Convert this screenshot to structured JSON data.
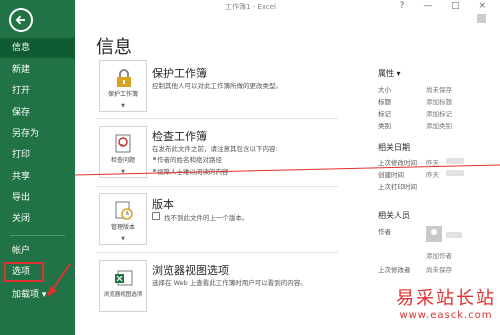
{
  "window": {
    "title": "工作簿1 - Excel",
    "controls": "? — □ ×"
  },
  "nav": {
    "items": [
      {
        "label": "信息",
        "active": true
      },
      {
        "label": "新建"
      },
      {
        "label": "打开"
      },
      {
        "label": "保存"
      },
      {
        "label": "另存为"
      },
      {
        "label": "打印"
      },
      {
        "label": "共享"
      },
      {
        "label": "导出"
      },
      {
        "label": "关闭"
      },
      {
        "label": "帐户"
      },
      {
        "label": "选项",
        "highlighted": true
      },
      {
        "label": "加载项 ▾"
      }
    ]
  },
  "main": {
    "page_title": "信息",
    "sections": [
      {
        "tile_label": "保护工作簿",
        "heading": "保护工作簿",
        "desc": "控制其他人可以对此工作簿所做的更改类型。",
        "icon": "lock-icon"
      },
      {
        "tile_label": "检查问题",
        "heading": "检查工作簿",
        "desc": "在发布此文件之前，请注意其包含以下内容:",
        "bullets": [
          "作者的姓名和绝对路径",
          "视障人士难以阅读的内容"
        ],
        "icon": "inspect-icon"
      },
      {
        "tile_label": "管理版本",
        "heading": "版本",
        "desc": "找不到此文件的上一个版本。",
        "icon": "versions-icon"
      },
      {
        "tile_label": "浏览器视图选项",
        "heading": "浏览器视图选项",
        "desc": "选择在 Web 上查看此工作簿时用户可以看到的内容。",
        "icon": "excel-browser-icon"
      }
    ]
  },
  "properties": {
    "heading": "属性 ▾",
    "rows": [
      {
        "key": "大小",
        "val": "尚未保存"
      },
      {
        "key": "标题",
        "val": "添加标题"
      },
      {
        "key": "标记",
        "val": "添加标记"
      },
      {
        "key": "类别",
        "val": "添加类别"
      }
    ],
    "dates_heading": "相关日期",
    "dates": [
      {
        "key": "上次修改时间",
        "val": "昨天"
      },
      {
        "key": "创建时间",
        "val": "昨天"
      },
      {
        "key": "上次打印时间",
        "val": ""
      }
    ],
    "people_heading": "相关人员",
    "people": [
      {
        "key": "作者",
        "val": "添加作者"
      },
      {
        "key": "上次修改者",
        "val": "尚未保存"
      }
    ]
  },
  "watermark": {
    "cn": "易采站长站",
    "url": "www.easck.com"
  },
  "colors": {
    "nav_bg": "#217346",
    "nav_active": "#0f5c33",
    "annotation_red": "#e0302f"
  }
}
